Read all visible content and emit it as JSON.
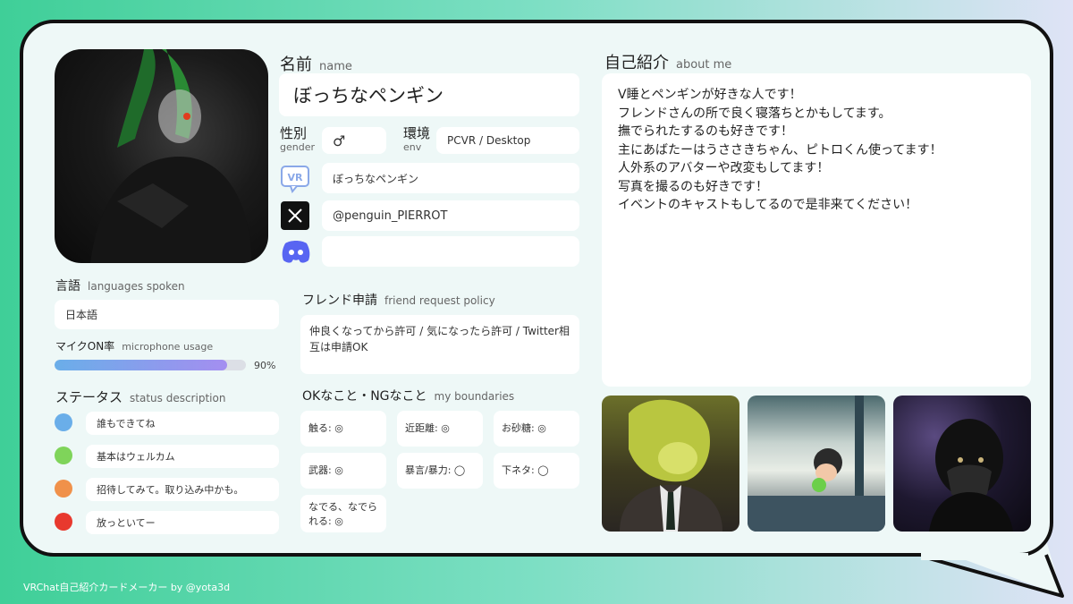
{
  "name": {
    "label_jp": "名前",
    "label_en": "name",
    "value": "ぼっちなペンギン"
  },
  "gender": {
    "label_jp": "性別",
    "label_en": "gender",
    "value": "♂"
  },
  "env": {
    "label_jp": "環境",
    "label_en": "env",
    "value": "PCVR / Desktop"
  },
  "vrchat_name": "ぼっちなペンギン",
  "x_handle": "@penguin_PIERROT",
  "discord": "",
  "languages": {
    "label_jp": "言語",
    "label_en": "languages spoken",
    "value": "日本語"
  },
  "mic": {
    "label_jp": "マイクON率",
    "label_en": "microphone usage",
    "percent_text": "90%",
    "percent": 90
  },
  "status": {
    "label_jp": "ステータス",
    "label_en": "status description",
    "items": [
      {
        "color": "#6aaee9",
        "text": "誰もできてね"
      },
      {
        "color": "#7fd45a",
        "text": "基本はウェルカム"
      },
      {
        "color": "#f0914a",
        "text": "招待してみて。取り込み中かも。"
      },
      {
        "color": "#e8392e",
        "text": "放っといてー"
      }
    ]
  },
  "friend": {
    "label_jp": "フレンド申請",
    "label_en": "friend request policy",
    "value": "仲良くなってから許可 / 気になったら許可 / Twitter相互は申請OK"
  },
  "boundaries": {
    "label_jp": "OKなこと・NGなこと",
    "label_en": "my boundaries",
    "items": [
      "触る: ◎",
      "近距離: ◎",
      "お砂糖: ◎",
      "武器: ◎",
      "暴言/暴力: ◯",
      "下ネタ: ◯",
      "なでる、なでられる: ◎"
    ]
  },
  "about": {
    "label_jp": "自己紹介",
    "label_en": "about me",
    "lines": [
      "V睡とペンギンが好きな人です！",
      "フレンドさんの所で良く寝落ちとかもしてます。",
      "撫でられたするのも好きです！",
      "主にあばたーはうささきちゃん、ピトロくん使ってます！",
      "人外系のアバターや改変もしてます！",
      "写真を撮るのも好きです！",
      "イベントのキャストもしてるので是非来てください！"
    ]
  },
  "footer": "VRChat自己紹介カードメーカー by @yota3d"
}
